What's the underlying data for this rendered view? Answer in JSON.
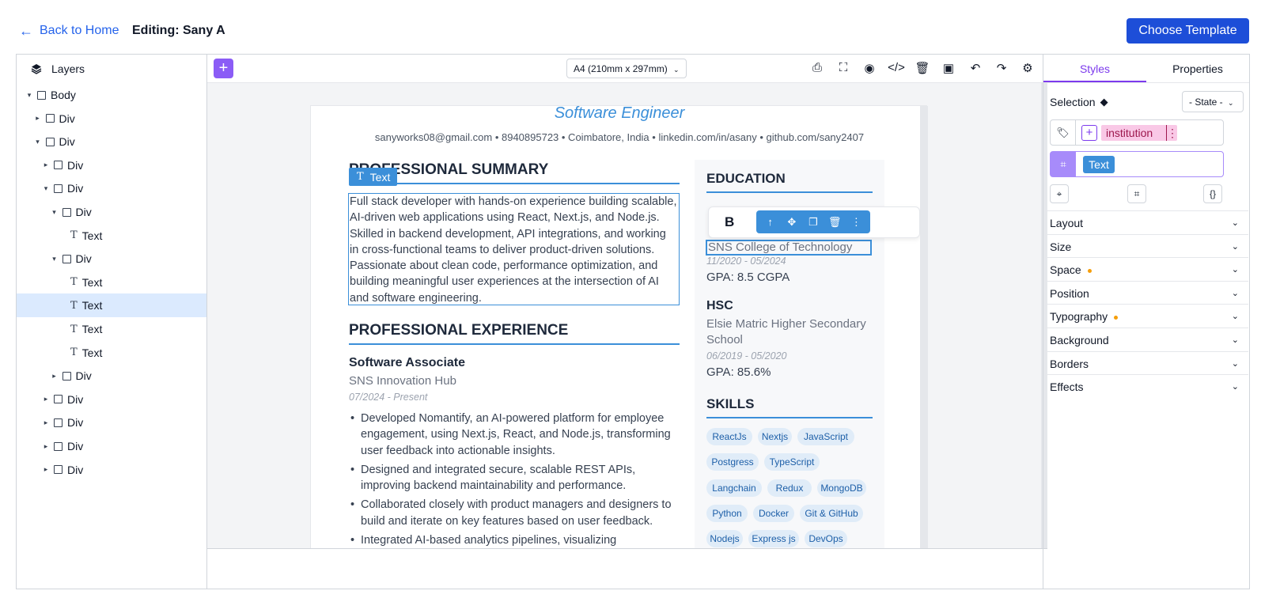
{
  "header": {
    "back_label": "Back to Home",
    "editing_title": "Editing: Sany A",
    "choose_template": "Choose Template"
  },
  "layers": {
    "title": "Layers",
    "tree": [
      {
        "label": "Body",
        "type": "box",
        "caret": "down"
      },
      {
        "label": "Div",
        "type": "box",
        "caret": "right"
      },
      {
        "label": "Div",
        "type": "box",
        "caret": "down"
      },
      {
        "label": "Div",
        "type": "box",
        "caret": "right"
      },
      {
        "label": "Div",
        "type": "box",
        "caret": "down"
      },
      {
        "label": "Div",
        "type": "box",
        "caret": "down"
      },
      {
        "label": "Text",
        "type": "text",
        "caret": ""
      },
      {
        "label": "Div",
        "type": "box",
        "caret": "down"
      },
      {
        "label": "Text",
        "type": "text",
        "caret": ""
      },
      {
        "label": "Text",
        "type": "text",
        "caret": "",
        "selected": true
      },
      {
        "label": "Text",
        "type": "text",
        "caret": ""
      },
      {
        "label": "Text",
        "type": "text",
        "caret": ""
      },
      {
        "label": "Div",
        "type": "box",
        "caret": "right"
      },
      {
        "label": "Div",
        "type": "box",
        "caret": "right"
      },
      {
        "label": "Div",
        "type": "box",
        "caret": "right"
      },
      {
        "label": "Div",
        "type": "box",
        "caret": "right"
      },
      {
        "label": "Div",
        "type": "box",
        "caret": "right"
      }
    ]
  },
  "toolbar": {
    "add": "+",
    "page_size": "A4 (210mm x 297mm)",
    "icons": [
      "print-icon",
      "fullscreen-icon",
      "preview-icon",
      "code-icon",
      "delete-icon",
      "save-icon",
      "undo-icon",
      "redo-icon",
      "settings-icon"
    ]
  },
  "resume": {
    "job_title": "Software Engineer",
    "contact": "sanyworks08@gmail.com • 8940895723 • Coimbatore, India • linkedin.com/in/asany • github.com/sany2407",
    "summary_title": "PROFESSIONAL SUMMARY",
    "text_badge": "Text",
    "summary": "Full stack developer with hands-on experience building scalable, AI-driven web applications using React, Next.js, and Node.js. Skilled in backend development, API integrations, and working in cross-functional teams to deliver product-driven solutions. Passionate about clean code, performance optimization, and building meaningful user experiences at the intersection of AI and software engineering.",
    "experience_title": "PROFESSIONAL EXPERIENCE",
    "experience": {
      "role": "Software Associate",
      "company": "SNS Innovation Hub",
      "dates": "07/2024 - Present",
      "bullets": [
        "Developed Nomantify, an AI-powered platform for employee engagement, using Next.js, React, and Node.js, transforming user feedback into actionable insights.",
        "Designed and integrated secure, scalable REST APIs, improving backend maintainability and performance.",
        "Collaborated closely with product managers and designers to build and iterate on key features based on user feedback.",
        "Integrated AI-based analytics pipelines, visualizing"
      ]
    },
    "education_title": "EDUCATION",
    "education": [
      {
        "institution": "SNS College of Technology",
        "dates": "11/2020 - 05/2024",
        "gpa": "GPA: 8.5 CGPA"
      },
      {
        "degree": "HSC",
        "institution": "Elsie Matric Higher Secondary School",
        "dates": "06/2019 - 05/2020",
        "gpa": "GPA: 85.6%"
      }
    ],
    "skills_title": "SKILLS",
    "skills": [
      "ReactJs",
      "Nextjs",
      "JavaScript",
      "Postgress",
      "TypeScript",
      "Langchain",
      "Redux",
      "MongoDB",
      "Python",
      "Docker",
      "Git & GitHub",
      "Nodejs",
      "Express js",
      "DevOps"
    ]
  },
  "float_toolbar": {
    "bold": "B",
    "actions": [
      "arrow-up-icon",
      "move-icon",
      "copy-icon",
      "trash-icon",
      "more-icon"
    ]
  },
  "right_panel": {
    "tabs": [
      "Styles",
      "Properties"
    ],
    "selection_label": "Selection",
    "state": "- State -",
    "class_name": "institution",
    "component": "Text",
    "sections": [
      {
        "label": "Layout",
        "modified": false
      },
      {
        "label": "Size",
        "modified": false
      },
      {
        "label": "Space",
        "modified": true
      },
      {
        "label": "Position",
        "modified": false
      },
      {
        "label": "Typography",
        "modified": true
      },
      {
        "label": "Background",
        "modified": false
      },
      {
        "label": "Borders",
        "modified": false
      },
      {
        "label": "Effects",
        "modified": false
      }
    ]
  },
  "colors": {
    "accent": "#3b8fd9",
    "primary_button": "#1d4ed8",
    "purple": "#7c3aed",
    "class_chip": "#f9c8e6"
  }
}
